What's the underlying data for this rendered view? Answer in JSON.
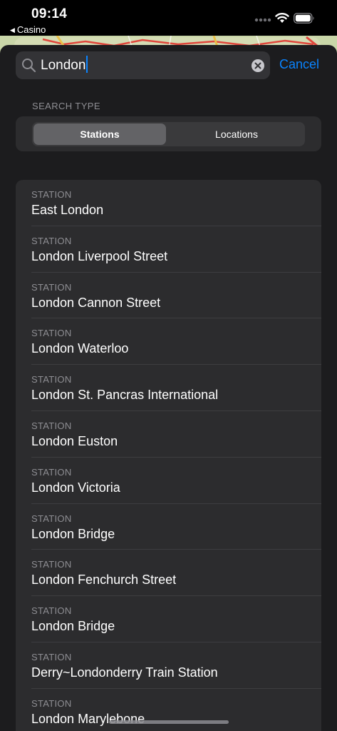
{
  "status_bar": {
    "time": "09:14",
    "back_app": "Casino"
  },
  "search": {
    "value": "London",
    "cancel_label": "Cancel"
  },
  "search_type": {
    "label": "SEARCH TYPE",
    "options": [
      "Stations",
      "Locations"
    ],
    "selected": "Stations"
  },
  "results": [
    {
      "kind": "STATION",
      "name": "East London"
    },
    {
      "kind": "STATION",
      "name": "London Liverpool Street"
    },
    {
      "kind": "STATION",
      "name": "London Cannon Street"
    },
    {
      "kind": "STATION",
      "name": "London Waterloo"
    },
    {
      "kind": "STATION",
      "name": "London St. Pancras International"
    },
    {
      "kind": "STATION",
      "name": "London Euston"
    },
    {
      "kind": "STATION",
      "name": "London Victoria"
    },
    {
      "kind": "STATION",
      "name": "London Bridge"
    },
    {
      "kind": "STATION",
      "name": "London Fenchurch Street"
    },
    {
      "kind": "STATION",
      "name": "London Bridge"
    },
    {
      "kind": "STATION",
      "name": "Derry~Londonderry Train Station"
    },
    {
      "kind": "STATION",
      "name": "London Marylebone"
    }
  ],
  "colors": {
    "accent": "#0a84ff",
    "sheet_background": "#1c1c1e",
    "card_background": "#2c2c2e",
    "secondary_text": "#8e8e93"
  },
  "icons": {
    "search": "magnifying-glass-icon",
    "clear": "x-circle-icon",
    "wifi": "wifi-icon",
    "battery": "battery-icon",
    "signal": "cellular-signal-icon",
    "back": "back-triangle-icon"
  }
}
